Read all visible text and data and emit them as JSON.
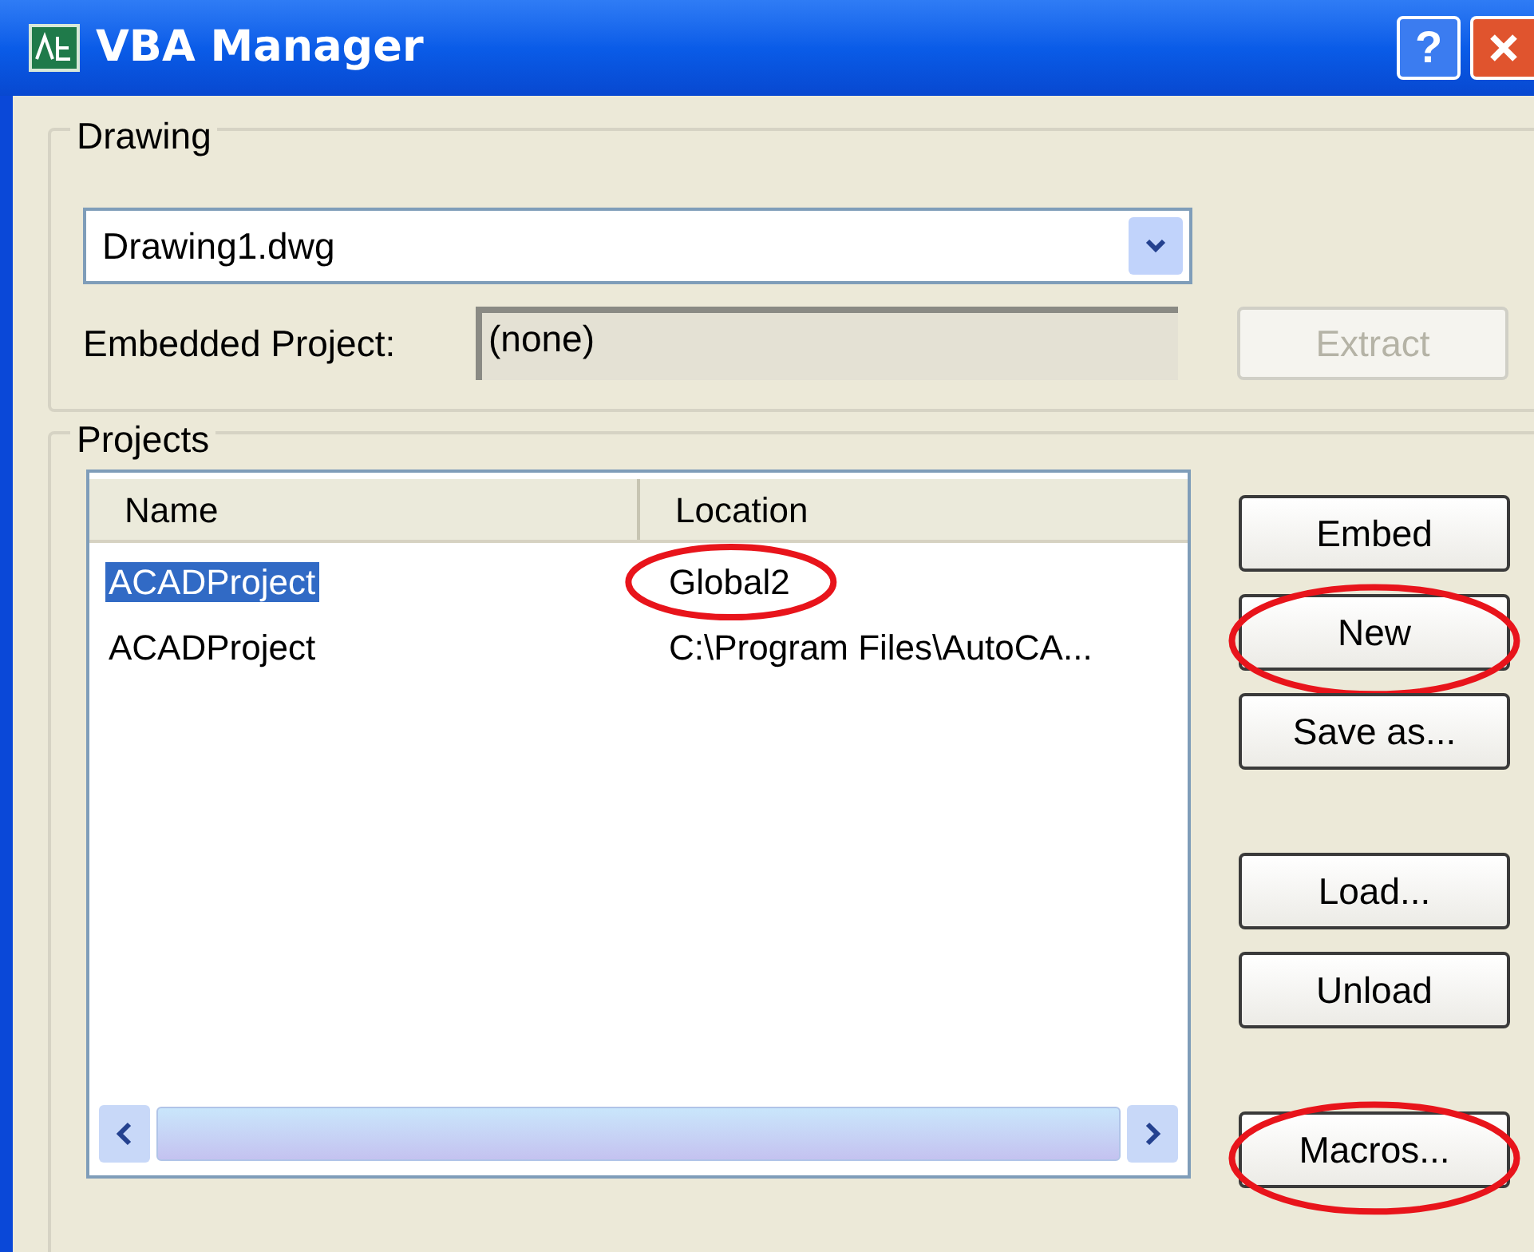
{
  "window": {
    "title": "VBA Manager",
    "help_label": "?"
  },
  "drawing": {
    "label": "Drawing",
    "dropdown": {
      "value": "Drawing1.dwg"
    },
    "embedded_label": "Embedded Project:",
    "embedded_value": "(none)",
    "extract": {
      "label": "Extract",
      "disabled": true
    }
  },
  "projects": {
    "label": "Projects",
    "columns": [
      {
        "label": "Name",
        "circled": false
      },
      {
        "label": "Location",
        "circled": false
      }
    ],
    "rows": [
      {
        "name": "ACADProject",
        "location": "Global2",
        "selected": true,
        "location_circled": true
      },
      {
        "name": "ACADProject",
        "location": "C:\\Program Files\\AutoCA...",
        "selected": false,
        "location_circled": false
      }
    ],
    "button_groups": [
      [
        {
          "label": "Embed",
          "circled": false
        },
        {
          "label": "New",
          "circled": true
        },
        {
          "label": "Save as...",
          "circled": false
        }
      ],
      [
        {
          "label": "Load...",
          "circled": false
        },
        {
          "label": "Unload",
          "circled": false
        }
      ],
      [
        {
          "label": "Macros...",
          "circled": true
        }
      ]
    ]
  }
}
